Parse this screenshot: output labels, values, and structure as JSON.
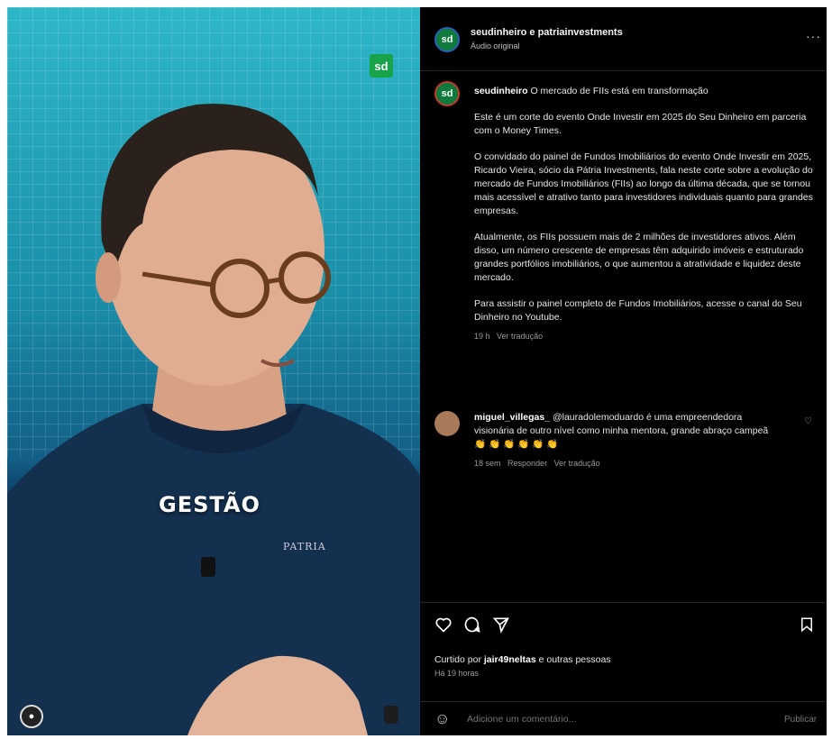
{
  "media": {
    "caption_overlay": "GESTÃO",
    "logo_text": "sd",
    "shirt_logo": "PATRIA"
  },
  "header": {
    "users": "seudinheiro e patriainvestments",
    "subtitle": "Áudio original"
  },
  "post": {
    "username": "seudinheiro",
    "headline": "O mercado de FIIs está em transformação",
    "paragraphs": [
      "Este é um corte do evento Onde Investir em 2025 do Seu Dinheiro em parceria com o Money Times.",
      "O convidado do painel de Fundos Imobiliários do evento Onde Investir em 2025, Ricardo Vieira, sócio da Pátria Investments, fala neste corte sobre a evolução do mercado de Fundos Imobiliários (FIIs) ao longo da última década, que se tornou mais acessível e atrativo tanto para investidores individuais quanto para grandes empresas.",
      "Atualmente, os FIIs possuem mais de 2 milhões de investidores ativos. Além disso, um número crescente de empresas têm adquirido imóveis e estruturado grandes portfólios imobiliários, o que aumentou a atratividade e liquidez deste mercado.",
      "Para assistir o painel completo de Fundos Imobiliários, acesse o canal do Seu Dinheiro no Youtube."
    ],
    "age": "19 h",
    "see_translation": "Ver tradução"
  },
  "comment": {
    "username": "miguel_villegas_",
    "text": "@lauradolemoduardo é uma empreendedora visionária de outro nível como minha mentora, grande abraço campeã",
    "emojis": "👏 👏 👏 👏 👏 👏",
    "age": "18 sem",
    "reply": "Responder",
    "see_translation": "Ver tradução"
  },
  "actions": {
    "like_icon": "heart-icon",
    "comment_icon": "comment-icon",
    "share_icon": "share-icon",
    "save_icon": "bookmark-icon"
  },
  "likes": {
    "prefix": "Curtido por",
    "user": "jair49neltas",
    "suffix": "e outras pessoas"
  },
  "timestamp": "Há 19 horas",
  "add_comment": {
    "placeholder": "Adicione um comentário...",
    "publish": "Publicar"
  }
}
